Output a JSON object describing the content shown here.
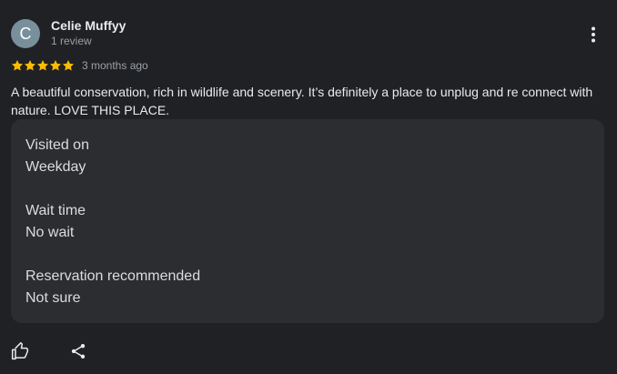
{
  "reviewer": {
    "initial": "C",
    "name": "Celie Muffyy",
    "review_count": "1 review",
    "avatar_color": "#78909c"
  },
  "rating": {
    "stars": 5,
    "max_stars": 5,
    "star_color": "#fbbc04",
    "date": "3 months ago"
  },
  "review_text": "A beautiful conservation, rich in wildlife and scenery. It’s definitely a place to unplug and re connect with nature. LOVE THIS PLACE.",
  "details": [
    {
      "label": "Visited on",
      "value": "Weekday"
    },
    {
      "label": "Wait time",
      "value": "No wait"
    },
    {
      "label": "Reservation recommended",
      "value": "Not sure"
    }
  ],
  "icons": {
    "more": "more-vert-icon",
    "like": "thumb-up-icon",
    "share": "share-icon"
  }
}
